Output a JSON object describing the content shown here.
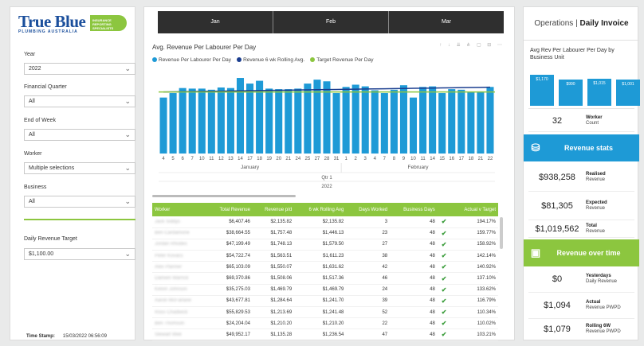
{
  "logo": {
    "brand": "True Blue",
    "subtitle": "PLUMBING AUSTRALIA",
    "tag": "INSURANCE REPORTING SPECIALISTS"
  },
  "filters": [
    {
      "label": "Year",
      "value": "2022"
    },
    {
      "label": "Financial Quarter",
      "value": "All"
    },
    {
      "label": "End of Week",
      "value": "All"
    },
    {
      "label": "Worker",
      "value": "Multiple selections"
    },
    {
      "label": "Business",
      "value": "All"
    }
  ],
  "revenue_target": {
    "label": "Daily Revenue Target",
    "value": "$1,100.00"
  },
  "timestamp": {
    "label": "Time Stamp:",
    "value": "15/03/2022 06:56:09"
  },
  "months": [
    "Jan",
    "Feb",
    "Mar"
  ],
  "chart_title": "Avg. Revenue Per Labourer Per Day",
  "chart_data": {
    "type": "bar",
    "categories": [
      "4",
      "5",
      "6",
      "7",
      "10",
      "11",
      "12",
      "13",
      "14",
      "17",
      "18",
      "19",
      "20",
      "21",
      "24",
      "25",
      "27",
      "28",
      "31",
      "1",
      "2",
      "3",
      "4",
      "7",
      "8",
      "9",
      "10",
      "11",
      "14",
      "15",
      "16",
      "17",
      "18",
      "21",
      "22"
    ],
    "series": [
      {
        "name": "Revenue Per Labourer Per Day",
        "color": "#1e9ad6",
        "values": [
          1000,
          1080,
          1170,
          1160,
          1160,
          1140,
          1180,
          1170,
          1350,
          1250,
          1300,
          1160,
          1150,
          1150,
          1160,
          1250,
          1320,
          1290,
          1080,
          1190,
          1230,
          1200,
          1130,
          1080,
          1140,
          1220,
          1000,
          1190,
          1200,
          1080,
          1150,
          1140,
          1100,
          1110,
          1190,
          1200
        ]
      },
      {
        "name": "Revenue 6 wk Rolling Avg.",
        "color": "#1a3d8f"
      },
      {
        "name": "Target Revenue Per Day",
        "color": "#8cc63f"
      }
    ],
    "xlabel_groups": [
      "January",
      "February"
    ],
    "quarter": "Qtr 1",
    "year": "2022"
  },
  "table": {
    "columns": [
      "Worker",
      "Total Revenue",
      "Revenue p/d",
      "6 wk Rolling Avg",
      "Days Worked",
      "Business Days",
      "Actual v Target"
    ],
    "rows": [
      [
        "Jack Siddys",
        "$6,407.46",
        "$2,135.82",
        "$2,135.82",
        "3",
        "48",
        "194.17%"
      ],
      [
        "Ben Cardamone",
        "$38,664.55",
        "$1,757.48",
        "$1,446.13",
        "23",
        "48",
        "159.77%"
      ],
      [
        "Jordan Rhodes",
        "$47,199.49",
        "$1,748.13",
        "$1,579.50",
        "27",
        "48",
        "158.92%"
      ],
      [
        "Peter Kovacs",
        "$54,722.74",
        "$1,563.51",
        "$1,611.23",
        "38",
        "48",
        "142.14%"
      ],
      [
        "Alex Planner",
        "$65,103.09",
        "$1,550.07",
        "$1,631.62",
        "42",
        "48",
        "140.92%"
      ],
      [
        "Damien Warrick",
        "$69,370.86",
        "$1,508.06",
        "$1,517.36",
        "46",
        "48",
        "137.10%"
      ],
      [
        "Kelvin Johnson",
        "$35,275.03",
        "$1,469.79",
        "$1,469.79",
        "24",
        "48",
        "133.62%"
      ],
      [
        "Aaron McFarlane",
        "$43,677.81",
        "$1,284.64",
        "$1,241.70",
        "39",
        "48",
        "116.79%"
      ],
      [
        "Ross Chadwick",
        "$55,829.53",
        "$1,213.69",
        "$1,241.48",
        "52",
        "48",
        "110.34%"
      ],
      [
        "Ben Thomson",
        "$24,204.04",
        "$1,210.20",
        "$1,210.20",
        "22",
        "48",
        "110.02%"
      ],
      [
        "Stewart Weil",
        "$49,952.17",
        "$1,135.28",
        "$1,236.54",
        "47",
        "48",
        "103.21%"
      ]
    ]
  },
  "right": {
    "title_left": "Operations",
    "title_right": "Daily Invoice",
    "bu_title": "Avg Rev Per Labourer Per Day by Business Unit",
    "bu_values": [
      1170,
      990,
      1015,
      1001
    ],
    "bu_labels": [
      "$1,170",
      "$990",
      "$1,015",
      "$1,001"
    ],
    "worker_count": {
      "value": "32",
      "label": "Worker",
      "sub": "Count"
    },
    "revenue_stats_banner": "Revenue stats",
    "stats": [
      {
        "value": "$938,258",
        "label": "Realised",
        "sub": "Revenue"
      },
      {
        "value": "$81,305",
        "label": "Expected",
        "sub": "Revenue"
      },
      {
        "value": "$1,019,562",
        "label": "Total",
        "sub": "Revenue"
      }
    ],
    "revenue_time_banner": "Revenue over time",
    "time_stats": [
      {
        "value": "$0",
        "label": "Yesterdays",
        "sub": "Daily Revenue"
      },
      {
        "value": "$1,094",
        "label": "Actual",
        "sub": "Revenue PWPD"
      },
      {
        "value": "$1,079",
        "label": "Rolling 6W",
        "sub": "Revenue PWPD"
      }
    ],
    "colors": {
      "blue": "#1e9ad6",
      "green": "#8cc63f"
    }
  }
}
